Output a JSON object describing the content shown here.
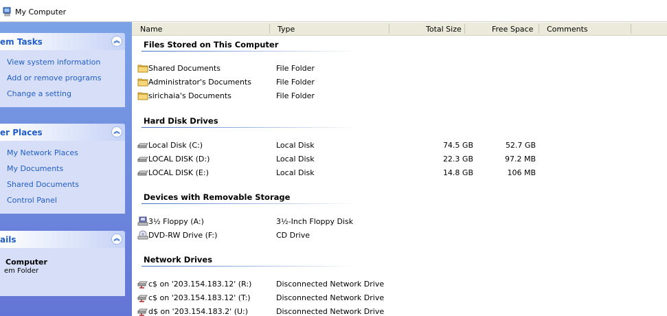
{
  "window": {
    "title": "My Computer"
  },
  "taskpane": {
    "system_tasks": {
      "title": "em Tasks",
      "links": [
        "View system information",
        "Add or remove programs",
        "Change a setting"
      ]
    },
    "other_places": {
      "title": "er Places",
      "links": [
        "My Network Places",
        "My Documents",
        "Shared Documents",
        "Control Panel"
      ]
    },
    "details": {
      "title": "ails",
      "name": "Computer",
      "type": "em Folder"
    }
  },
  "columns": [
    "Name",
    "Type",
    "Total Size",
    "Free Space",
    "Comments"
  ],
  "sections": [
    {
      "title": "Files Stored on This Computer",
      "items": [
        {
          "icon": "folder-icon",
          "name": "Shared Documents",
          "type": "File Folder",
          "total": "",
          "free": ""
        },
        {
          "icon": "folder-icon",
          "name": "Administrator's Documents",
          "type": "File Folder",
          "total": "",
          "free": ""
        },
        {
          "icon": "folder-icon",
          "name": "sirichaia's Documents",
          "type": "File Folder",
          "total": "",
          "free": ""
        }
      ]
    },
    {
      "title": "Hard Disk Drives",
      "items": [
        {
          "icon": "hard-disk-icon",
          "name": "Local Disk (C:)",
          "type": "Local Disk",
          "total": "74.5 GB",
          "free": "52.7 GB"
        },
        {
          "icon": "hard-disk-icon",
          "name": "LOCAL DISK (D:)",
          "type": "Local Disk",
          "total": "22.3 GB",
          "free": "97.2 MB"
        },
        {
          "icon": "hard-disk-icon",
          "name": "LOCAL DISK (E:)",
          "type": "Local Disk",
          "total": "14.8 GB",
          "free": "106 MB"
        }
      ]
    },
    {
      "title": "Devices with Removable Storage",
      "items": [
        {
          "icon": "floppy-drive-icon",
          "name": "3½ Floppy (A:)",
          "type": "3½-Inch Floppy Disk",
          "total": "",
          "free": ""
        },
        {
          "icon": "dvd-drive-icon",
          "name": "DVD-RW Drive (F:)",
          "type": "CD Drive",
          "total": "",
          "free": ""
        }
      ]
    },
    {
      "title": "Network Drives",
      "items": [
        {
          "icon": "network-drive-icon",
          "name": "c$ on '203.154.183.12' (R:)",
          "type": "Disconnected Network Drive",
          "total": "",
          "free": ""
        },
        {
          "icon": "network-drive-icon",
          "name": "c$ on '203.154.183.12' (T:)",
          "type": "Disconnected Network Drive",
          "total": "",
          "free": ""
        },
        {
          "icon": "network-drive-icon",
          "name": "d$ on '203.154.183.2' (U:)",
          "type": "Disconnected Network Drive",
          "total": "",
          "free": ""
        }
      ]
    }
  ]
}
